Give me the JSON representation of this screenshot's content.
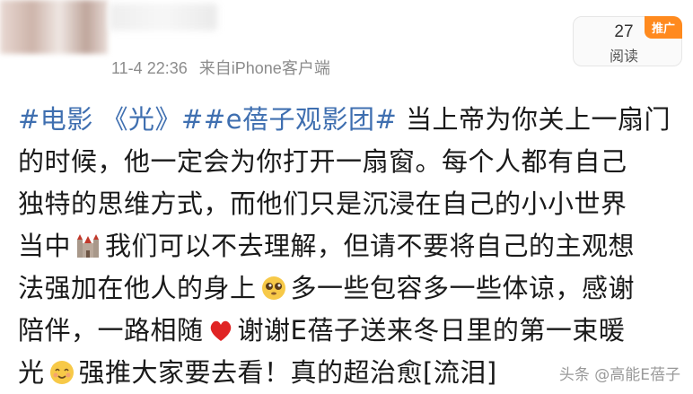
{
  "meta": {
    "time": "11-4 22:36",
    "client": "来自iPhone客户端"
  },
  "reads": {
    "count": "27",
    "label": "阅读",
    "ad": "推广"
  },
  "post": {
    "tag1": "#电影 《光》#",
    "tag2": "#e蓓子观影团#",
    "l1_text": " 当上帝为你关上一扇门",
    "l2_text": "的时候，他一定会为你打开一扇窗。每个人都有自己",
    "l3_text": "独特的思维方式，而他们只是沉浸在自己的小小世界",
    "l4_a": "当中",
    "l4_b": "我们可以不去理解，但请不要将自己的主观想",
    "l5_a": "法强加在他人的身上",
    "l5_b": "多一些包容多一些体谅，感谢",
    "l6_a": "陪伴，一路相随",
    "l6_b": "谢谢E蓓子送来冬日里的第一束暖",
    "l7_a": "光",
    "l7_b": "强推大家要去看！真的超治愈[流泪]"
  },
  "watermark": "头条 @高能E蓓子"
}
